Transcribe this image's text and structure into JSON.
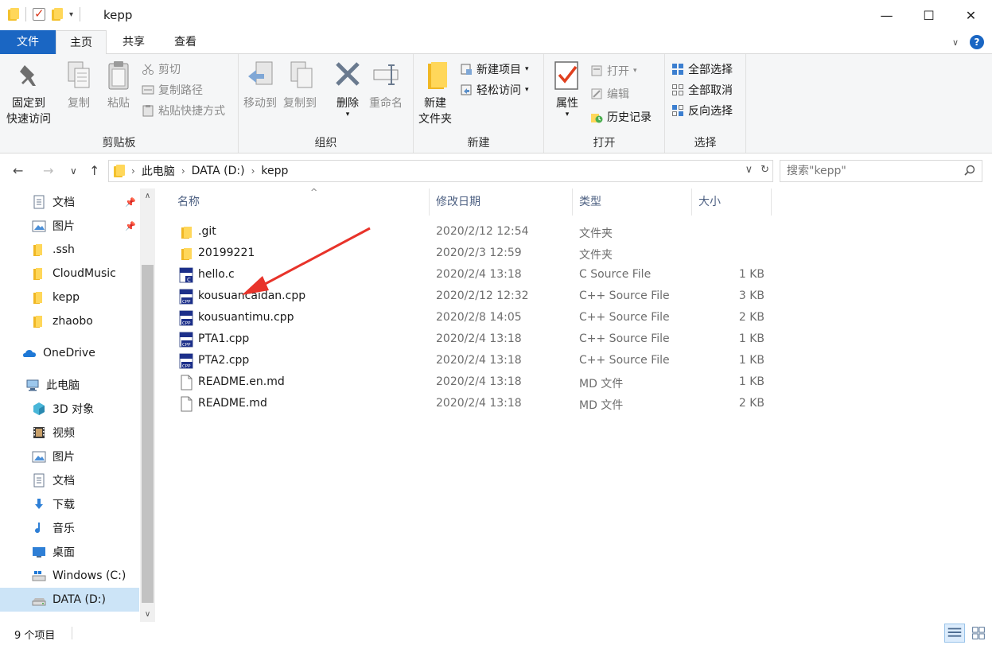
{
  "window": {
    "title": "kepp",
    "minimize": "—",
    "maximize": "☐",
    "close": "✕"
  },
  "tabs": [
    {
      "label": "文件"
    },
    {
      "label": "主页"
    },
    {
      "label": "共享"
    },
    {
      "label": "查看"
    }
  ],
  "ribbon": {
    "clipboard": {
      "label": "剪贴板",
      "pin_line1": "固定到",
      "pin_line2": "快速访问",
      "copy": "复制",
      "paste": "粘贴",
      "cut": "剪切",
      "copy_path": "复制路径",
      "paste_shortcut": "粘贴快捷方式"
    },
    "organize": {
      "label": "组织",
      "move_to": "移动到",
      "copy_to": "复制到",
      "delete": "删除",
      "rename": "重命名"
    },
    "new": {
      "label": "新建",
      "new_folder_line1": "新建",
      "new_folder_line2": "文件夹",
      "new_item": "新建项目",
      "easy_access": "轻松访问"
    },
    "open": {
      "label": "打开",
      "properties": "属性",
      "open": "打开",
      "edit": "编辑",
      "history": "历史记录"
    },
    "select": {
      "label": "选择",
      "select_all": "全部选择",
      "select_none": "全部取消",
      "invert": "反向选择"
    }
  },
  "address": {
    "crumbs": [
      "此电脑",
      "DATA (D:)",
      "kepp"
    ],
    "search_placeholder": "搜索\"kepp\""
  },
  "nav": {
    "items": [
      {
        "label": "文档",
        "icon": "documents-icon",
        "pinned": true
      },
      {
        "label": "图片",
        "icon": "pictures-icon",
        "pinned": true
      },
      {
        "label": ".ssh",
        "icon": "folder-icon"
      },
      {
        "label": "CloudMusic",
        "icon": "folder-icon"
      },
      {
        "label": "kepp",
        "icon": "folder-icon"
      },
      {
        "label": "zhaobo",
        "icon": "folder-icon"
      },
      {
        "label": "OneDrive",
        "icon": "onedrive-icon"
      },
      {
        "label": "此电脑",
        "icon": "this-pc-icon"
      },
      {
        "label": "3D 对象",
        "icon": "3d-objects-icon"
      },
      {
        "label": "视频",
        "icon": "videos-icon"
      },
      {
        "label": "图片",
        "icon": "pictures-icon"
      },
      {
        "label": "文档",
        "icon": "documents-icon"
      },
      {
        "label": "下载",
        "icon": "downloads-icon"
      },
      {
        "label": "音乐",
        "icon": "music-icon"
      },
      {
        "label": "桌面",
        "icon": "desktop-icon"
      },
      {
        "label": "Windows (C:)",
        "icon": "windows-drive-icon"
      },
      {
        "label": "DATA (D:)",
        "icon": "drive-icon",
        "selected": true
      }
    ]
  },
  "columns": {
    "name": "名称",
    "modified": "修改日期",
    "type": "类型",
    "size": "大小"
  },
  "files": [
    {
      "name": ".git",
      "modified": "2020/2/12 12:54",
      "type": "文件夹",
      "size": "",
      "icon": "folder-icon"
    },
    {
      "name": "20199221",
      "modified": "2020/2/3 12:59",
      "type": "文件夹",
      "size": "",
      "icon": "folder-icon"
    },
    {
      "name": "hello.c",
      "modified": "2020/2/4 13:18",
      "type": "C Source File",
      "size": "1 KB",
      "icon": "c-file-icon"
    },
    {
      "name": "kousuancaidan.cpp",
      "modified": "2020/2/12 12:32",
      "type": "C++ Source File",
      "size": "3 KB",
      "icon": "cpp-file-icon"
    },
    {
      "name": "kousuantimu.cpp",
      "modified": "2020/2/8 14:05",
      "type": "C++ Source File",
      "size": "2 KB",
      "icon": "cpp-file-icon"
    },
    {
      "name": "PTA1.cpp",
      "modified": "2020/2/4 13:18",
      "type": "C++ Source File",
      "size": "1 KB",
      "icon": "cpp-file-icon"
    },
    {
      "name": "PTA2.cpp",
      "modified": "2020/2/4 13:18",
      "type": "C++ Source File",
      "size": "1 KB",
      "icon": "cpp-file-icon"
    },
    {
      "name": "README.en.md",
      "modified": "2020/2/4 13:18",
      "type": "MD 文件",
      "size": "1 KB",
      "icon": "md-file-icon"
    },
    {
      "name": "README.md",
      "modified": "2020/2/4 13:18",
      "type": "MD 文件",
      "size": "2 KB",
      "icon": "md-file-icon"
    }
  ],
  "status": {
    "count": "9 个项目"
  },
  "colors": {
    "accent": "#1a66c3",
    "folder": "#ffd75a",
    "annotation": "#e8332a",
    "selected": "#cce4f7"
  }
}
